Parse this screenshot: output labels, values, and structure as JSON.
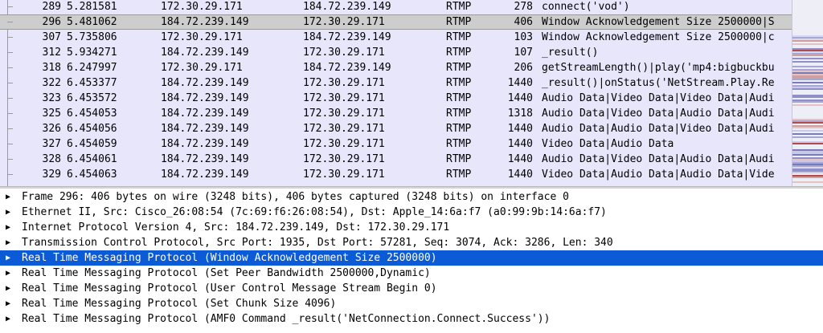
{
  "packet_list": {
    "rows": [
      {
        "no": "289",
        "time": "5.281581",
        "src": "172.30.29.171",
        "dst": "184.72.239.149",
        "proto": "RTMP",
        "len": "278",
        "info": "connect('vod')",
        "selected": false
      },
      {
        "no": "296",
        "time": "5.481062",
        "src": "184.72.239.149",
        "dst": "172.30.29.171",
        "proto": "RTMP",
        "len": "406",
        "info": "Window Acknowledgement Size 2500000|S",
        "selected": true
      },
      {
        "no": "307",
        "time": "5.735806",
        "src": "172.30.29.171",
        "dst": "184.72.239.149",
        "proto": "RTMP",
        "len": "103",
        "info": "Window Acknowledgement Size 2500000|c",
        "selected": false
      },
      {
        "no": "312",
        "time": "5.934271",
        "src": "184.72.239.149",
        "dst": "172.30.29.171",
        "proto": "RTMP",
        "len": "107",
        "info": "_result()",
        "selected": false
      },
      {
        "no": "318",
        "time": "6.247997",
        "src": "172.30.29.171",
        "dst": "184.72.239.149",
        "proto": "RTMP",
        "len": "206",
        "info": "getStreamLength()|play('mp4:bigbuckbu",
        "selected": false
      },
      {
        "no": "322",
        "time": "6.453377",
        "src": "184.72.239.149",
        "dst": "172.30.29.171",
        "proto": "RTMP",
        "len": "1440",
        "info": "_result()|onStatus('NetStream.Play.Re",
        "selected": false
      },
      {
        "no": "323",
        "time": "6.453572",
        "src": "184.72.239.149",
        "dst": "172.30.29.171",
        "proto": "RTMP",
        "len": "1440",
        "info": "Audio Data|Video Data|Video Data|Audi",
        "selected": false
      },
      {
        "no": "325",
        "time": "6.454053",
        "src": "184.72.239.149",
        "dst": "172.30.29.171",
        "proto": "RTMP",
        "len": "1318",
        "info": "Audio Data|Video Data|Audio Data|Audi",
        "selected": false
      },
      {
        "no": "326",
        "time": "6.454056",
        "src": "184.72.239.149",
        "dst": "172.30.29.171",
        "proto": "RTMP",
        "len": "1440",
        "info": "Audio Data|Audio Data|Video Data|Audi",
        "selected": false
      },
      {
        "no": "327",
        "time": "6.454059",
        "src": "184.72.239.149",
        "dst": "172.30.29.171",
        "proto": "RTMP",
        "len": "1440",
        "info": "Video Data|Audio Data",
        "selected": false
      },
      {
        "no": "328",
        "time": "6.454061",
        "src": "184.72.239.149",
        "dst": "172.30.29.171",
        "proto": "RTMP",
        "len": "1440",
        "info": "Audio Data|Video Data|Audio Data|Audi",
        "selected": false
      },
      {
        "no": "329",
        "time": "6.454063",
        "src": "184.72.239.149",
        "dst": "172.30.29.171",
        "proto": "RTMP",
        "len": "1440",
        "info": "Video Data|Audio Data|Audio Data|Vide",
        "selected": false
      }
    ]
  },
  "details": {
    "items": [
      {
        "label": "Frame 296: 406 bytes on wire (3248 bits), 406 bytes captured (3248 bits) on interface 0",
        "selected": false
      },
      {
        "label": "Ethernet II, Src: Cisco_26:08:54 (7c:69:f6:26:08:54), Dst: Apple_14:6a:f7 (a0:99:9b:14:6a:f7)",
        "selected": false
      },
      {
        "label": "Internet Protocol Version 4, Src: 184.72.239.149, Dst: 172.30.29.171",
        "selected": false
      },
      {
        "label": "Transmission Control Protocol, Src Port: 1935, Dst Port: 57281, Seq: 3074, Ack: 3286, Len: 340",
        "selected": false
      },
      {
        "label": "Real Time Messaging Protocol (Window Acknowledgement Size 2500000)",
        "selected": true
      },
      {
        "label": "Real Time Messaging Protocol (Set Peer Bandwidth 2500000,Dynamic)",
        "selected": false
      },
      {
        "label": "Real Time Messaging Protocol (User Control Message Stream Begin 0)",
        "selected": false
      },
      {
        "label": "Real Time Messaging Protocol (Set Chunk Size 4096)",
        "selected": false
      },
      {
        "label": "Real Time Messaging Protocol (AMF0 Command _result('NetConnection.Connect.Success'))",
        "selected": false
      }
    ]
  },
  "colors": {
    "list_background": "#e7e6fb",
    "list_selected": "#cdcdcd",
    "detail_selected": "#0c5bd6"
  }
}
